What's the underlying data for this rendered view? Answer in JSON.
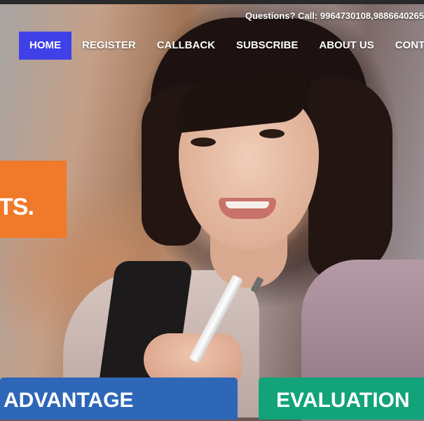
{
  "header": {
    "contact": "Questions? Call: 9964730108,9886640265"
  },
  "nav": {
    "items": [
      "HOME",
      "REGISTER",
      "CALLBACK",
      "SUBSCRIBE",
      "ABOUT US",
      "CONT"
    ],
    "active": "HOME"
  },
  "slide": {
    "caption_fragment": "TS."
  },
  "tiles": {
    "advantage": "ADVANTAGE",
    "evaluation": "EVALUATION"
  },
  "colors": {
    "nav_active": "#4040e8",
    "caption_box": "#f07a2a",
    "tile_blue": "#2e66b8",
    "tile_green": "#12a37a"
  }
}
